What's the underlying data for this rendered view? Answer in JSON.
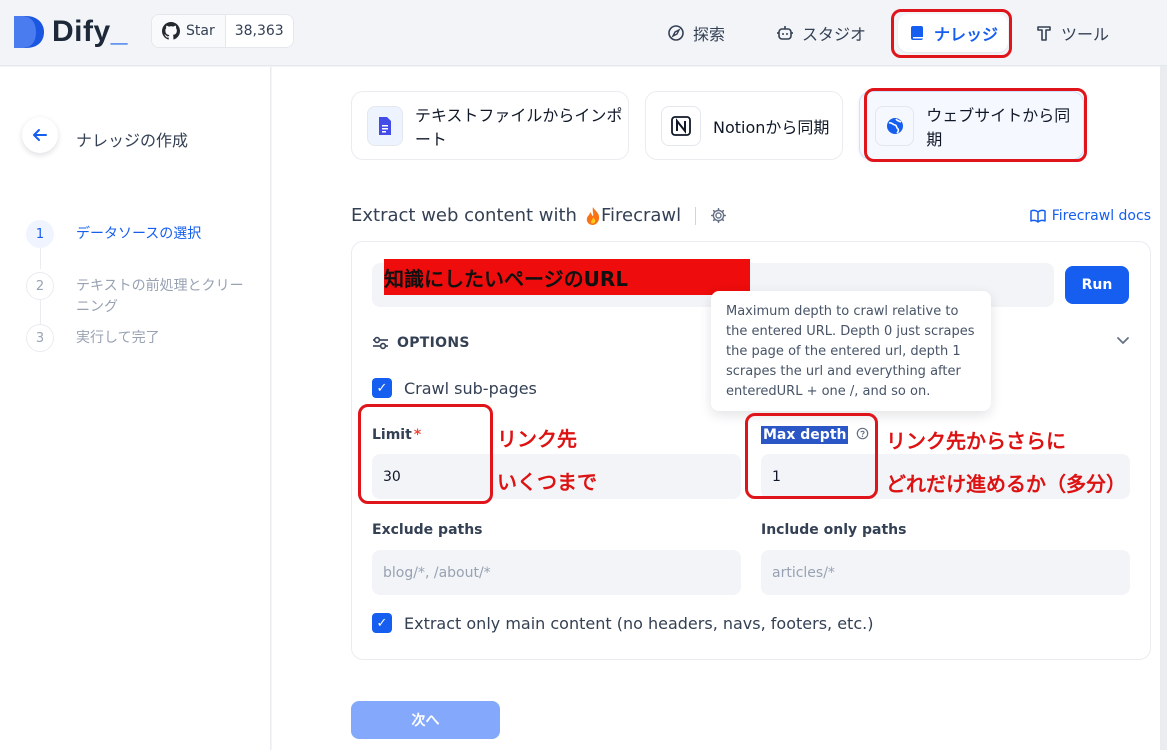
{
  "header": {
    "logo_text": "Dify",
    "logo_underscore": "_",
    "star_label": "Star",
    "star_count": "38,363",
    "nav": [
      {
        "label": "探索",
        "icon": "compass-icon"
      },
      {
        "label": "スタジオ",
        "icon": "robot-icon"
      },
      {
        "label": "ナレッジ",
        "icon": "book-icon",
        "active": true
      },
      {
        "label": "ツール",
        "icon": "tool-icon"
      }
    ]
  },
  "sidebar": {
    "title": "ナレッジの作成",
    "steps": [
      {
        "num": "1",
        "label": "データソースの選択",
        "active": true
      },
      {
        "num": "2",
        "label": "テキストの前処理とクリーニング"
      },
      {
        "num": "3",
        "label": "実行して完了"
      }
    ]
  },
  "sources": [
    {
      "label": "テキストファイルからインポート",
      "icon": "file-icon"
    },
    {
      "label": "Notionから同期",
      "icon": "notion-icon"
    },
    {
      "label": "ウェブサイトから同期",
      "icon": "globe-icon",
      "active": true
    }
  ],
  "extract": {
    "title_prefix": "Extract web content with",
    "provider": "Firecrawl",
    "docs_link": "Firecrawl docs",
    "url_annotation": "知識にしたいページのURL",
    "run_label": "Run",
    "options_label": "OPTIONS",
    "crawl_sub_pages": "Crawl sub-pages",
    "limit_label": "Limit",
    "limit_value": "30",
    "max_depth_label": "Max depth",
    "max_depth_value": "1",
    "exclude_label": "Exclude paths",
    "exclude_placeholder": "blog/*, /about/*",
    "include_label": "Include only paths",
    "include_placeholder": "articles/*",
    "main_content_label": "Extract only main content (no headers, navs, footers, etc.)",
    "tooltip": "Maximum depth to crawl relative to the entered URL. Depth 0 just scrapes the page of the entered url, depth 1 scrapes the url and everything after enteredURL + one /, and so on."
  },
  "annotations": {
    "limit_line1": "リンク先",
    "limit_line2": "いくつまで",
    "depth_line1": "リンク先からさらに",
    "depth_line2": "どれだけ進めるか（多分）"
  },
  "footer": {
    "next_label": "次へ"
  },
  "colors": {
    "accent": "#155eef",
    "annotation_red": "#e0151b",
    "next_disabled": "#84a9fc"
  }
}
